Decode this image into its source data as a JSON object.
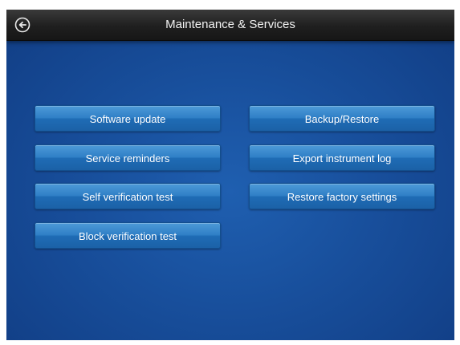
{
  "header": {
    "title": "Maintenance & Services",
    "back_icon": "back-arrow-circle-icon"
  },
  "buttons": {
    "left": [
      "Software update",
      "Service reminders",
      "Self verification test",
      "Block verification test"
    ],
    "right": [
      "Backup/Restore",
      "Export instrument log",
      "Restore factory settings"
    ]
  },
  "colors": {
    "background": "#184f9c",
    "header": "#1f1f1f",
    "button": "#2f7fc6",
    "text": "#ffffff"
  }
}
